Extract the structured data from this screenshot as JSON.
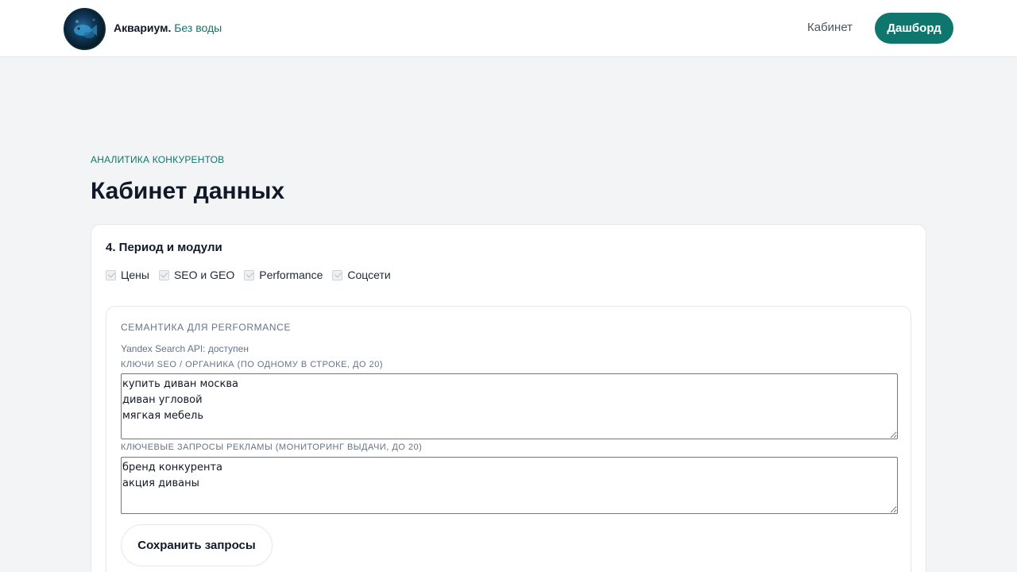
{
  "header": {
    "brand_name": "Аквариум.",
    "brand_tagline": "Без воды",
    "nav_link": "Кабинет",
    "nav_button": "Дашборд"
  },
  "page": {
    "eyebrow": "АНАЛИТИКА КОНКУРЕНТОВ",
    "title": "Кабинет данных"
  },
  "period_section": {
    "title": "4. Период и модули",
    "modules": [
      {
        "label": "Цены",
        "checked": true
      },
      {
        "label": "SEO и GEO",
        "checked": true
      },
      {
        "label": "Performance",
        "checked": true
      },
      {
        "label": "Соцсети",
        "checked": true
      }
    ]
  },
  "semantics": {
    "title": "СЕМАНТИКА ДЛЯ PERFORMANCE",
    "api_status": "Yandex Search API: доступен",
    "seo_keys_label": "КЛЮЧИ SEO / ОРГАНИКА (ПО ОДНОМУ В СТРОКЕ, ДО 20)",
    "seo_keys_value": "купить диван москва\nдиван угловой\nмягкая мебель",
    "ad_keys_label": "КЛЮЧЕВЫЕ ЗАПРОСЫ РЕКЛАМЫ (МОНИТОРИНГ ВЫДАЧИ, ДО 20)",
    "ad_keys_value": "бренд конкурента\nакция диваны",
    "save_button": "Сохранить запросы"
  }
}
